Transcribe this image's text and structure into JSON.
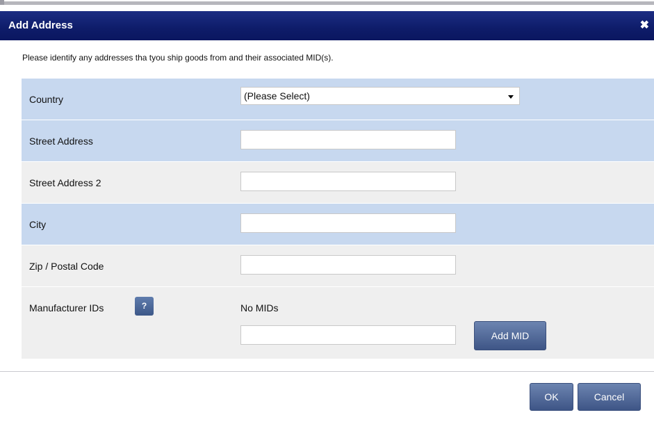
{
  "dialog": {
    "title": "Add Address",
    "close_glyph": "✖",
    "intro": "Please identify any addresses tha tyou ship goods from and their associated MID(s)."
  },
  "form": {
    "country": {
      "label": "Country",
      "selected": "(Please Select)"
    },
    "street": {
      "label": "Street Address",
      "value": ""
    },
    "street2": {
      "label": "Street Address 2",
      "value": ""
    },
    "city": {
      "label": "City",
      "value": ""
    },
    "zip": {
      "label": "Zip / Postal Code",
      "value": ""
    },
    "mids": {
      "label": "Manufacturer IDs",
      "help_glyph": "?",
      "empty_text": "No MIDs",
      "input_value": "",
      "add_label": "Add MID"
    }
  },
  "footer": {
    "ok_label": "OK",
    "cancel_label": "Cancel"
  },
  "colors": {
    "title_bar": "#0e1c69",
    "row_blue": "#c7d8ef",
    "row_gray": "#efefef",
    "button": "#4f6796"
  }
}
